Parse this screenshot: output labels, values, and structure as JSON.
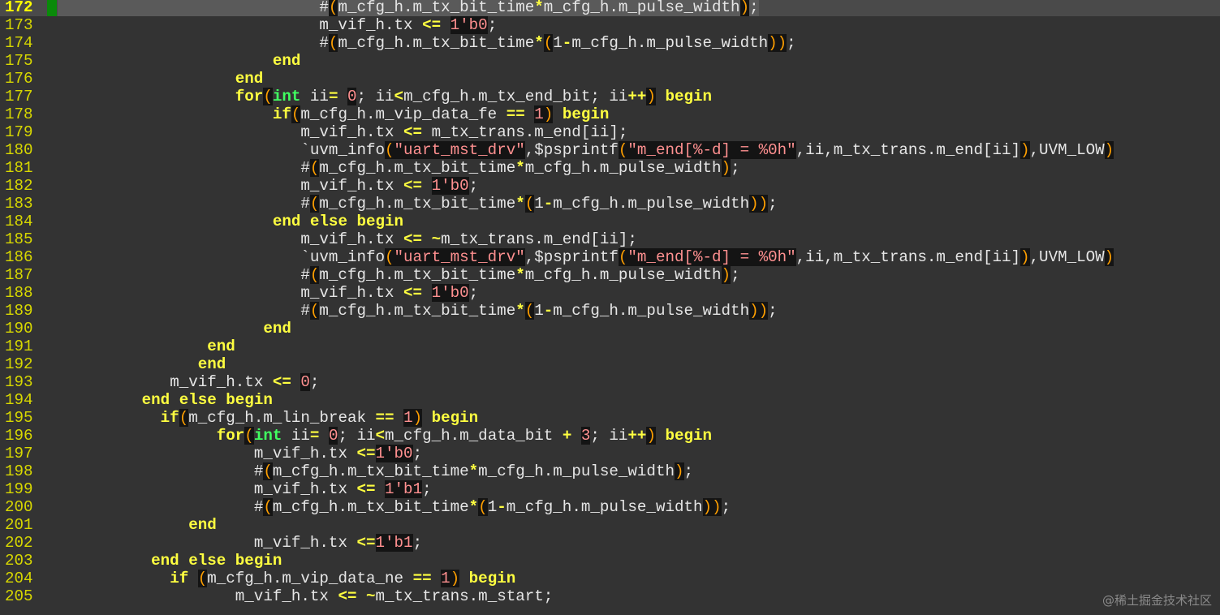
{
  "editor": {
    "current_line": "172",
    "lines": [
      {
        "num": "172",
        "indent": "                            ",
        "tokens": [
          [
            "plain",
            "#"
          ],
          [
            "br",
            "("
          ],
          [
            "plain",
            "m_cfg_h.m_tx_bit_time"
          ],
          [
            "op",
            "*"
          ],
          [
            "plain",
            "m_cfg_h.m_pulse_width"
          ],
          [
            "br",
            ")"
          ],
          [
            "plain",
            ";"
          ]
        ]
      },
      {
        "num": "173",
        "indent": "                            ",
        "tokens": [
          [
            "plain",
            "m_vif_h.tx "
          ],
          [
            "op",
            "<="
          ],
          [
            "plain",
            " "
          ],
          [
            "num",
            "1'b0"
          ],
          [
            "plain",
            ";"
          ]
        ]
      },
      {
        "num": "174",
        "indent": "                            ",
        "tokens": [
          [
            "plain",
            "#"
          ],
          [
            "br",
            "("
          ],
          [
            "plain",
            "m_cfg_h.m_tx_bit_time"
          ],
          [
            "op",
            "*"
          ],
          [
            "br",
            "("
          ],
          [
            "plain",
            "1"
          ],
          [
            "op",
            "-"
          ],
          [
            "plain",
            "m_cfg_h.m_pulse_width"
          ],
          [
            "br",
            "))"
          ],
          [
            "plain",
            ";"
          ]
        ]
      },
      {
        "num": "175",
        "indent": "                       ",
        "tokens": [
          [
            "kw",
            "end"
          ]
        ]
      },
      {
        "num": "176",
        "indent": "                   ",
        "tokens": [
          [
            "kw",
            "end"
          ]
        ]
      },
      {
        "num": "177",
        "indent": "                   ",
        "tokens": [
          [
            "kw",
            "for"
          ],
          [
            "br",
            "("
          ],
          [
            "ty",
            "int"
          ],
          [
            "plain",
            " ii"
          ],
          [
            "op",
            "="
          ],
          [
            "plain",
            " "
          ],
          [
            "num",
            "0"
          ],
          [
            "plain",
            "; ii"
          ],
          [
            "op",
            "<"
          ],
          [
            "plain",
            "m_cfg_h.m_tx_end_bit; ii"
          ],
          [
            "op",
            "++"
          ],
          [
            "br",
            ")"
          ],
          [
            "plain",
            " "
          ],
          [
            "kw",
            "begin"
          ]
        ]
      },
      {
        "num": "178",
        "indent": "                       ",
        "tokens": [
          [
            "kw",
            "if"
          ],
          [
            "br",
            "("
          ],
          [
            "plain",
            "m_cfg_h.m_vip_data_fe "
          ],
          [
            "op",
            "=="
          ],
          [
            "plain",
            " "
          ],
          [
            "num",
            "1"
          ],
          [
            "br",
            ")"
          ],
          [
            "plain",
            " "
          ],
          [
            "kw",
            "begin"
          ]
        ]
      },
      {
        "num": "179",
        "indent": "                          ",
        "tokens": [
          [
            "plain",
            "m_vif_h.tx "
          ],
          [
            "op",
            "<="
          ],
          [
            "plain",
            " m_tx_trans.m_end[ii];"
          ]
        ]
      },
      {
        "num": "180",
        "indent": "                          ",
        "tokens": [
          [
            "plain",
            "`uvm_info"
          ],
          [
            "br",
            "("
          ],
          [
            "str",
            "\"uart_mst_drv\""
          ],
          [
            "plain",
            ",$psprintf"
          ],
          [
            "br",
            "("
          ],
          [
            "str",
            "\"m_end[%-d] = %0h\""
          ],
          [
            "plain",
            ",ii,m_tx_trans.m_end[ii]"
          ],
          [
            "br",
            ")"
          ],
          [
            "plain",
            ",UVM_LOW"
          ],
          [
            "br",
            ")"
          ]
        ]
      },
      {
        "num": "181",
        "indent": "                          ",
        "tokens": [
          [
            "plain",
            "#"
          ],
          [
            "br",
            "("
          ],
          [
            "plain",
            "m_cfg_h.m_tx_bit_time"
          ],
          [
            "op",
            "*"
          ],
          [
            "plain",
            "m_cfg_h.m_pulse_width"
          ],
          [
            "br",
            ")"
          ],
          [
            "plain",
            ";"
          ]
        ]
      },
      {
        "num": "182",
        "indent": "                          ",
        "tokens": [
          [
            "plain",
            "m_vif_h.tx "
          ],
          [
            "op",
            "<="
          ],
          [
            "plain",
            " "
          ],
          [
            "num",
            "1'b0"
          ],
          [
            "plain",
            ";"
          ]
        ]
      },
      {
        "num": "183",
        "indent": "                          ",
        "tokens": [
          [
            "plain",
            "#"
          ],
          [
            "br",
            "("
          ],
          [
            "plain",
            "m_cfg_h.m_tx_bit_time"
          ],
          [
            "op",
            "*"
          ],
          [
            "br",
            "("
          ],
          [
            "plain",
            "1"
          ],
          [
            "op",
            "-"
          ],
          [
            "plain",
            "m_cfg_h.m_pulse_width"
          ],
          [
            "br",
            "))"
          ],
          [
            "plain",
            ";"
          ]
        ]
      },
      {
        "num": "184",
        "indent": "                       ",
        "tokens": [
          [
            "kw",
            "end else begin"
          ]
        ]
      },
      {
        "num": "185",
        "indent": "                          ",
        "tokens": [
          [
            "plain",
            "m_vif_h.tx "
          ],
          [
            "op",
            "<="
          ],
          [
            "plain",
            " "
          ],
          [
            "op",
            "~"
          ],
          [
            "plain",
            "m_tx_trans.m_end[ii];"
          ]
        ]
      },
      {
        "num": "186",
        "indent": "                          ",
        "tokens": [
          [
            "plain",
            "`uvm_info"
          ],
          [
            "br",
            "("
          ],
          [
            "str",
            "\"uart_mst_drv\""
          ],
          [
            "plain",
            ",$psprintf"
          ],
          [
            "br",
            "("
          ],
          [
            "str",
            "\"m_end[%-d] = %0h\""
          ],
          [
            "plain",
            ",ii,m_tx_trans.m_end[ii]"
          ],
          [
            "br",
            ")"
          ],
          [
            "plain",
            ",UVM_LOW"
          ],
          [
            "br",
            ")"
          ]
        ]
      },
      {
        "num": "187",
        "indent": "                          ",
        "tokens": [
          [
            "plain",
            "#"
          ],
          [
            "br",
            "("
          ],
          [
            "plain",
            "m_cfg_h.m_tx_bit_time"
          ],
          [
            "op",
            "*"
          ],
          [
            "plain",
            "m_cfg_h.m_pulse_width"
          ],
          [
            "br",
            ")"
          ],
          [
            "plain",
            ";"
          ]
        ]
      },
      {
        "num": "188",
        "indent": "                          ",
        "tokens": [
          [
            "plain",
            "m_vif_h.tx "
          ],
          [
            "op",
            "<="
          ],
          [
            "plain",
            " "
          ],
          [
            "num",
            "1'b0"
          ],
          [
            "plain",
            ";"
          ]
        ]
      },
      {
        "num": "189",
        "indent": "                          ",
        "tokens": [
          [
            "plain",
            "#"
          ],
          [
            "br",
            "("
          ],
          [
            "plain",
            "m_cfg_h.m_tx_bit_time"
          ],
          [
            "op",
            "*"
          ],
          [
            "br",
            "("
          ],
          [
            "plain",
            "1"
          ],
          [
            "op",
            "-"
          ],
          [
            "plain",
            "m_cfg_h.m_pulse_width"
          ],
          [
            "br",
            "))"
          ],
          [
            "plain",
            ";"
          ]
        ]
      },
      {
        "num": "190",
        "indent": "                      ",
        "tokens": [
          [
            "kw",
            "end"
          ]
        ]
      },
      {
        "num": "191",
        "indent": "                ",
        "tokens": [
          [
            "kw",
            "end"
          ]
        ]
      },
      {
        "num": "192",
        "indent": "               ",
        "tokens": [
          [
            "kw",
            "end"
          ]
        ]
      },
      {
        "num": "193",
        "indent": "            ",
        "tokens": [
          [
            "plain",
            "m_vif_h.tx "
          ],
          [
            "op",
            "<="
          ],
          [
            "plain",
            " "
          ],
          [
            "num",
            "0"
          ],
          [
            "plain",
            ";"
          ]
        ]
      },
      {
        "num": "194",
        "indent": "         ",
        "tokens": [
          [
            "kw",
            "end else begin"
          ]
        ]
      },
      {
        "num": "195",
        "indent": "           ",
        "tokens": [
          [
            "kw",
            "if"
          ],
          [
            "br",
            "("
          ],
          [
            "plain",
            "m_cfg_h.m_lin_break "
          ],
          [
            "op",
            "=="
          ],
          [
            "plain",
            " "
          ],
          [
            "num",
            "1"
          ],
          [
            "br",
            ")"
          ],
          [
            "plain",
            " "
          ],
          [
            "kw",
            "begin"
          ]
        ]
      },
      {
        "num": "196",
        "indent": "                 ",
        "tokens": [
          [
            "kw",
            "for"
          ],
          [
            "br",
            "("
          ],
          [
            "ty",
            "int"
          ],
          [
            "plain",
            " ii"
          ],
          [
            "op",
            "="
          ],
          [
            "plain",
            " "
          ],
          [
            "num",
            "0"
          ],
          [
            "plain",
            "; ii"
          ],
          [
            "op",
            "<"
          ],
          [
            "plain",
            "m_cfg_h.m_data_bit "
          ],
          [
            "op",
            "+"
          ],
          [
            "plain",
            " "
          ],
          [
            "num",
            "3"
          ],
          [
            "plain",
            "; ii"
          ],
          [
            "op",
            "++"
          ],
          [
            "br",
            ")"
          ],
          [
            "plain",
            " "
          ],
          [
            "kw",
            "begin"
          ]
        ]
      },
      {
        "num": "197",
        "indent": "                     ",
        "tokens": [
          [
            "plain",
            "m_vif_h.tx "
          ],
          [
            "op",
            "<="
          ],
          [
            "num",
            "1'b0"
          ],
          [
            "plain",
            ";"
          ]
        ]
      },
      {
        "num": "198",
        "indent": "                     ",
        "tokens": [
          [
            "plain",
            "#"
          ],
          [
            "br",
            "("
          ],
          [
            "plain",
            "m_cfg_h.m_tx_bit_time"
          ],
          [
            "op",
            "*"
          ],
          [
            "plain",
            "m_cfg_h.m_pulse_width"
          ],
          [
            "br",
            ")"
          ],
          [
            "plain",
            ";"
          ]
        ]
      },
      {
        "num": "199",
        "indent": "                     ",
        "tokens": [
          [
            "plain",
            "m_vif_h.tx "
          ],
          [
            "op",
            "<="
          ],
          [
            "plain",
            " "
          ],
          [
            "num",
            "1'b1"
          ],
          [
            "plain",
            ";"
          ]
        ]
      },
      {
        "num": "200",
        "indent": "                     ",
        "tokens": [
          [
            "plain",
            "#"
          ],
          [
            "br",
            "("
          ],
          [
            "plain",
            "m_cfg_h.m_tx_bit_time"
          ],
          [
            "op",
            "*"
          ],
          [
            "br",
            "("
          ],
          [
            "plain",
            "1"
          ],
          [
            "op",
            "-"
          ],
          [
            "plain",
            "m_cfg_h.m_pulse_width"
          ],
          [
            "br",
            "))"
          ],
          [
            "plain",
            ";"
          ]
        ]
      },
      {
        "num": "201",
        "indent": "              ",
        "tokens": [
          [
            "kw",
            "end"
          ]
        ]
      },
      {
        "num": "202",
        "indent": "                     ",
        "tokens": [
          [
            "plain",
            "m_vif_h.tx "
          ],
          [
            "op",
            "<="
          ],
          [
            "num",
            "1'b1"
          ],
          [
            "plain",
            ";"
          ]
        ]
      },
      {
        "num": "203",
        "indent": "          ",
        "tokens": [
          [
            "kw",
            "end else begin"
          ]
        ]
      },
      {
        "num": "204",
        "indent": "            ",
        "tokens": [
          [
            "kw",
            "if"
          ],
          [
            "plain",
            " "
          ],
          [
            "br",
            "("
          ],
          [
            "plain",
            "m_cfg_h.m_vip_data_ne "
          ],
          [
            "op",
            "=="
          ],
          [
            "plain",
            " "
          ],
          [
            "num",
            "1"
          ],
          [
            "br",
            ")"
          ],
          [
            "plain",
            " "
          ],
          [
            "kw",
            "begin"
          ]
        ]
      },
      {
        "num": "205",
        "indent": "                   ",
        "tokens": [
          [
            "plain",
            "m_vif_h.tx "
          ],
          [
            "op",
            "<="
          ],
          [
            "plain",
            " "
          ],
          [
            "op",
            "~"
          ],
          [
            "plain",
            "m_tx_trans.m_start;"
          ]
        ]
      }
    ]
  },
  "watermark": {
    "text": "@稀土掘金技术社区"
  }
}
